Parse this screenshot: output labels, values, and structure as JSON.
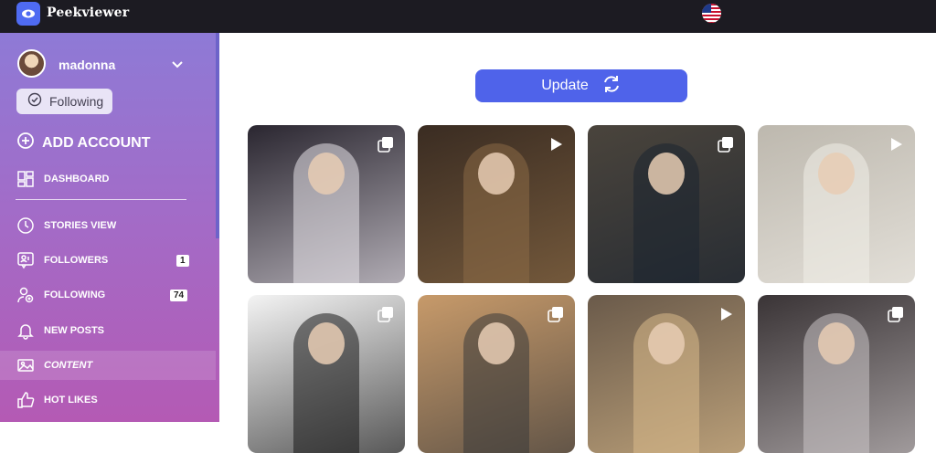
{
  "app": {
    "brand": "Peekviewer",
    "logo_icon": "eye-icon",
    "flag_icon": "us-flag-icon"
  },
  "profile": {
    "username": "madonna",
    "following_label": "Following"
  },
  "sidebar": {
    "add_account": "ADD ACCOUNT",
    "items": [
      {
        "label": "DASHBOARD",
        "icon": "dashboard-icon"
      },
      {
        "label": "STORIES VIEW",
        "icon": "clock-icon"
      },
      {
        "label": "FOLLOWERS",
        "icon": "followers-icon",
        "count": "1"
      },
      {
        "label": "FOLLOWING",
        "icon": "following-icon",
        "count": "74"
      },
      {
        "label": "NEW POSTS",
        "icon": "bell-icon"
      },
      {
        "label": "CONTENT",
        "icon": "image-icon",
        "active": true
      },
      {
        "label": "HOT LIKES",
        "icon": "thumbs-up-icon"
      }
    ]
  },
  "main": {
    "update_label": "Update",
    "posts": [
      {
        "type": "carousel",
        "bg": "#2a2630",
        "accent": "#e6e1e8"
      },
      {
        "type": "video",
        "bg": "#3a2c22",
        "accent": "#8a6a45"
      },
      {
        "type": "carousel",
        "bg": "#4a443c",
        "accent": "#1b2430"
      },
      {
        "type": "video",
        "bg": "#bdb8ae",
        "accent": "#f1eee8"
      },
      {
        "type": "carousel",
        "bg": "#f4f4f4",
        "accent": "#1a1a1a"
      },
      {
        "type": "carousel",
        "bg": "#c79a6a",
        "accent": "#3b3a3a"
      },
      {
        "type": "video",
        "bg": "#6a5a4a",
        "accent": "#d8b98a"
      },
      {
        "type": "carousel",
        "bg": "#3a3436",
        "accent": "#c9c3c4"
      }
    ]
  }
}
